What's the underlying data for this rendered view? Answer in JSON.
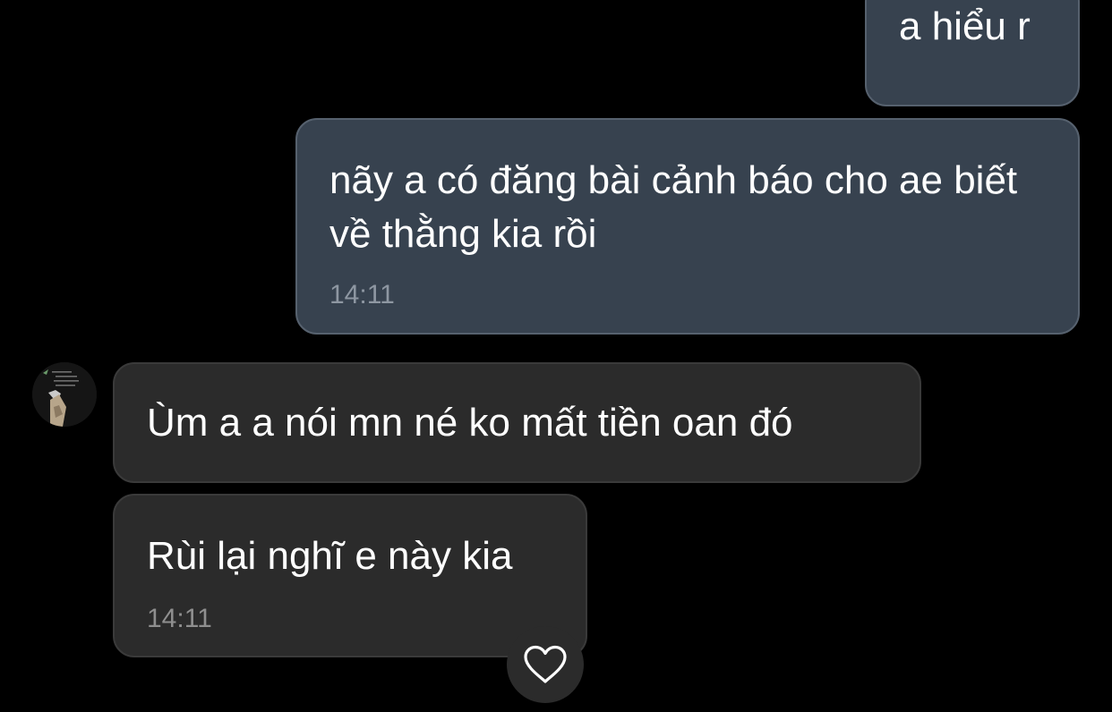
{
  "chat": {
    "messages": [
      {
        "direction": "outgoing",
        "text": "a hiểu r",
        "time": ""
      },
      {
        "direction": "outgoing",
        "text": "nãy a có đăng bài cảnh báo cho ae biết về thằng kia rồi",
        "time": "14:11"
      },
      {
        "direction": "incoming",
        "text": "Ùm a a nói mn né ko mất tiền oan đó",
        "time": ""
      },
      {
        "direction": "incoming",
        "text": "Rùi lại nghĩ e này kia",
        "time": "14:11"
      }
    ],
    "contact_avatar": {
      "icon": "contact-avatar"
    },
    "reaction_button": {
      "icon": "heart-icon"
    }
  },
  "colors": {
    "background": "#000000",
    "outgoing_bubble": "#37424f",
    "incoming_bubble": "#2b2b2b",
    "text": "#ffffff",
    "timestamp": "#8e97a2"
  }
}
